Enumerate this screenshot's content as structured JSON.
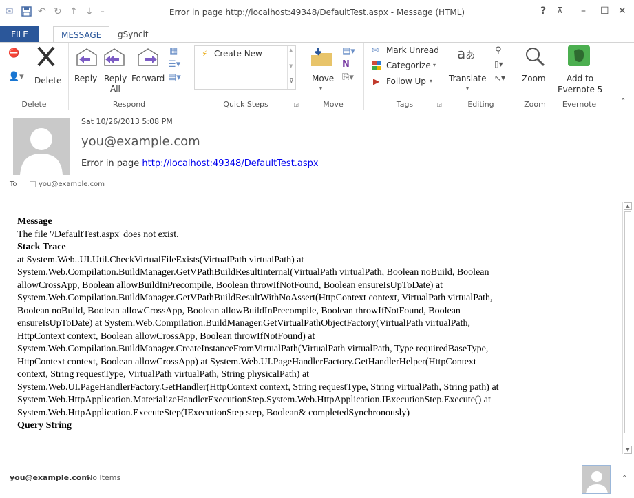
{
  "window": {
    "title": "Error in page http://localhost:49348/DefaultTest.aspx - Message (HTML)",
    "help": "?"
  },
  "tabs": [
    "FILE",
    "MESSAGE",
    "gSyncit"
  ],
  "ribbon": {
    "delete": {
      "delete_label": "Delete",
      "group_label": "Delete"
    },
    "respond": {
      "reply": "Reply",
      "reply_all_1": "Reply",
      "reply_all_2": "All",
      "forward": "Forward",
      "group_label": "Respond"
    },
    "quick_steps": {
      "create_new": "Create New",
      "group_label": "Quick Steps"
    },
    "move": {
      "move_label": "Move",
      "group_label": "Move"
    },
    "tags": {
      "mark_unread": "Mark Unread",
      "categorize": "Categorize",
      "follow_up": "Follow Up",
      "group_label": "Tags"
    },
    "editing": {
      "translate": "Translate",
      "group_label": "Editing"
    },
    "zoom": {
      "zoom_label": "Zoom",
      "group_label": "Zoom"
    },
    "evernote": {
      "add_1": "Add to",
      "add_2": "Evernote 5",
      "group_label": "Evernote"
    }
  },
  "message_header": {
    "date": "Sat 10/26/2013 5:08 PM",
    "from": "you@example.com",
    "subject_prefix": "Error in page ",
    "subject_link": "http://localhost:49348/DefaultTest.aspx",
    "to_label": "To",
    "to_value": "you@example.com"
  },
  "body": {
    "message_heading": "Message",
    "message_text": "The file '/DefaultTest.aspx' does not exist.",
    "stack_heading": "Stack Trace",
    "stack_lines": [
      "at System.Web..UI.Util.CheckVirtualFileExists(VirtualPath virtualPath) at",
      "System.Web.Compilation.BuildManager.GetVPathBuildResultInternal(VirtualPath virtualPath, Boolean noBuild, Boolean",
      "allowCrossApp, Boolean allowBuildInPrecompile, Boolean throwIfNotFound, Boolean ensureIsUpToDate) at",
      "System.Web.Compilation.BuildManager.GetVPathBuildResultWithNoAssert(HttpContext context, VirtualPath virtualPath,",
      "Boolean noBuild, Boolean allowCrossApp, Boolean allowBuildInPrecompile, Boolean throwIfNotFound, Boolean",
      "ensureIsUpToDate) at System.Web.Compilation.BuildManager.GetVirtualPathObjectFactory(VirtualPath virtualPath,",
      "HttpContext context, Boolean allowCrossApp, Boolean throwIfNotFound) at",
      "System.Web.Compilation.BuildManager.CreateInstanceFromVirtualPath(VirtualPath virtualPath, Type requiredBaseType,",
      "HttpContext context, Boolean allowCrossApp) at System.Web.UI.PageHandlerFactory.GetHandlerHelper(HttpContext",
      "context, String requestType, VirtualPath virtualPath, String physicalPath) at",
      "System.Web.UI.PageHandlerFactory.GetHandler(HttpContext context, String requestType, String virtualPath, String path) at",
      "System.Web.HttpApplication.MaterializeHandlerExecutionStep.System.Web.HttpApplication.IExecutionStep.Execute() at",
      "System.Web.HttpApplication.ExecuteStep(IExecutionStep step, Boolean& completedSynchronously)"
    ],
    "query_heading": "Query String"
  },
  "status": {
    "account": "you@example.com",
    "items": "No Items"
  },
  "colors": {
    "accent": "#2b579a",
    "link": "#0000ee",
    "evernote": "#4caf50"
  }
}
